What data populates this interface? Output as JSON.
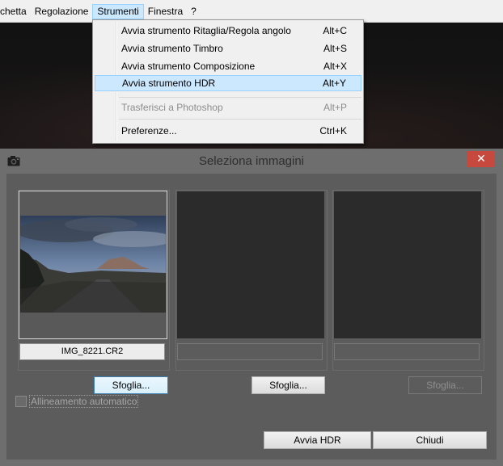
{
  "menubar": {
    "items": [
      {
        "label": "chetta"
      },
      {
        "label": "Regolazione"
      },
      {
        "label": "Strumenti"
      },
      {
        "label": "Finestra"
      },
      {
        "label": "?"
      }
    ]
  },
  "dropdown": {
    "items": [
      {
        "label": "Avvia strumento Ritaglia/Regola angolo",
        "shortcut": "Alt+C"
      },
      {
        "label": "Avvia strumento Timbro",
        "shortcut": "Alt+S"
      },
      {
        "label": "Avvia strumento Composizione",
        "shortcut": "Alt+X"
      },
      {
        "label": "Avvia strumento HDR",
        "shortcut": "Alt+Y"
      },
      {
        "label": "Trasferisci a Photoshop",
        "shortcut": "Alt+P"
      },
      {
        "label": "Preferenze...",
        "shortcut": "Ctrl+K"
      }
    ]
  },
  "dialog": {
    "title": "Seleziona immagini",
    "close_label": "✕",
    "slots": [
      {
        "filename": "IMG_8221.CR2",
        "browse_label": "Sfoglia..."
      },
      {
        "filename": "",
        "browse_label": "Sfoglia..."
      },
      {
        "filename": "",
        "browse_label": "Sfoglia..."
      }
    ],
    "auto_align_label": "Allineamento automatico",
    "start_hdr_label": "Avvia HDR",
    "close_button_label": "Chiudi"
  },
  "icons": {
    "camera": "camera-icon",
    "close": "close-icon"
  },
  "colors": {
    "highlight": "#cce8ff",
    "highlight_border": "#99d1ff",
    "dialog_bg": "#5c5c5c",
    "close_red": "#c7493e"
  }
}
